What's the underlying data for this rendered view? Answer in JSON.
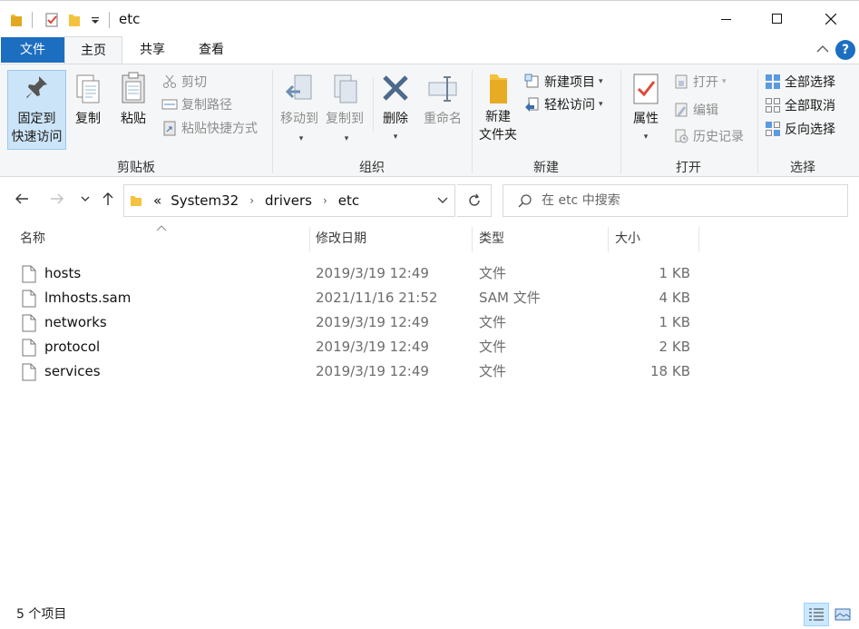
{
  "window": {
    "title": "etc"
  },
  "tabs": {
    "file": "文件",
    "home": "主页",
    "share": "共享",
    "view": "查看",
    "help": "?"
  },
  "ribbon": {
    "clipboard": {
      "label": "剪贴板",
      "pin_line1": "固定到",
      "pin_line2": "快速访问",
      "copy": "复制",
      "paste": "粘贴",
      "cut": "剪切",
      "copy_path": "复制路径",
      "paste_shortcut": "粘贴快捷方式"
    },
    "organize": {
      "label": "组织",
      "move_to": "移动到",
      "copy_to": "复制到",
      "delete": "删除",
      "rename": "重命名"
    },
    "new": {
      "label": "新建",
      "new_folder_line1": "新建",
      "new_folder_line2": "文件夹",
      "new_item": "新建项目",
      "easy_access": "轻松访问"
    },
    "open": {
      "label": "打开",
      "properties": "属性",
      "open": "打开",
      "edit": "编辑",
      "history": "历史记录"
    },
    "select": {
      "label": "选择",
      "select_all": "全部选择",
      "select_none": "全部取消",
      "invert": "反向选择"
    }
  },
  "address": {
    "overflow": "«",
    "crumbs": [
      "System32",
      "drivers",
      "etc"
    ]
  },
  "search": {
    "placeholder": "在 etc 中搜索"
  },
  "columns": {
    "name": "名称",
    "date": "修改日期",
    "type": "类型",
    "size": "大小"
  },
  "files": [
    {
      "name": "hosts",
      "date": "2019/3/19 12:49",
      "type": "文件",
      "size": "1 KB"
    },
    {
      "name": "lmhosts.sam",
      "date": "2021/11/16 21:52",
      "type": "SAM 文件",
      "size": "4 KB"
    },
    {
      "name": "networks",
      "date": "2019/3/19 12:49",
      "type": "文件",
      "size": "1 KB"
    },
    {
      "name": "protocol",
      "date": "2019/3/19 12:49",
      "type": "文件",
      "size": "2 KB"
    },
    {
      "name": "services",
      "date": "2019/3/19 12:49",
      "type": "文件",
      "size": "18 KB"
    }
  ],
  "status": {
    "count": "5 个项目"
  },
  "colors": {
    "accent": "#1c6ec0",
    "ribbon_bg": "#f5f6f7",
    "pin_highlight": "#cce4f7",
    "folder": "#f3c23f"
  }
}
